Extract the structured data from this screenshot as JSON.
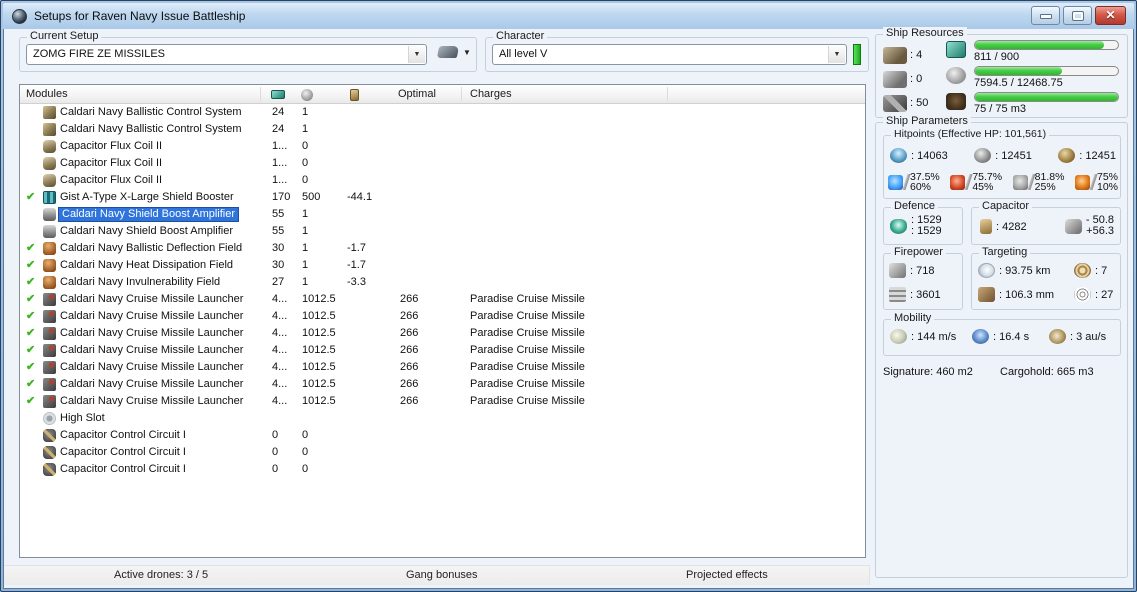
{
  "colors": {
    "accent_green": "#2db82d",
    "selection_blue": "#2e74da",
    "titlebar_blue": "#bcd7ef"
  },
  "window": {
    "title": "Setups for Raven Navy Issue Battleship"
  },
  "toolbar": {
    "current_setup": {
      "label": "Current Setup",
      "value": "ZOMG FIRE ZE MISSILES"
    },
    "character": {
      "label": "Character",
      "value": "All level V"
    }
  },
  "modules": {
    "header": {
      "name": "Modules",
      "optimal": "Optimal",
      "charges": "Charges"
    },
    "check_glyph": "✔",
    "rows": [
      {
        "icon": "bcs",
        "name": "Caldari Navy Ballistic Control System",
        "cpu": "24",
        "pg": "1"
      },
      {
        "icon": "bcs",
        "name": "Caldari Navy Ballistic Control System",
        "cpu": "24",
        "pg": "1"
      },
      {
        "icon": "fluxcoil",
        "name": "Capacitor Flux Coil II",
        "cpu": "1...",
        "pg": "0"
      },
      {
        "icon": "fluxcoil",
        "name": "Capacitor Flux Coil II",
        "cpu": "1...",
        "pg": "0"
      },
      {
        "icon": "fluxcoil",
        "name": "Capacitor Flux Coil II",
        "cpu": "1...",
        "pg": "0"
      },
      {
        "check": true,
        "icon": "booster",
        "name": "Gist A-Type X-Large Shield Booster",
        "cpu": "170",
        "pg": "500",
        "cap": "-44.1"
      },
      {
        "icon": "amplifier",
        "name": "Caldari Navy Shield Boost Amplifier",
        "cpu": "55",
        "pg": "1",
        "selected": true
      },
      {
        "icon": "amplifier",
        "name": "Caldari Navy Shield Boost Amplifier",
        "cpu": "55",
        "pg": "1"
      },
      {
        "check": true,
        "icon": "hardener",
        "name": "Caldari Navy Ballistic Deflection Field",
        "cpu": "30",
        "pg": "1",
        "cap": "-1.7"
      },
      {
        "check": true,
        "icon": "hardener",
        "name": "Caldari Navy Heat Dissipation Field",
        "cpu": "30",
        "pg": "1",
        "cap": "-1.7"
      },
      {
        "check": true,
        "icon": "hardener",
        "name": "Caldari Navy Invulnerability Field",
        "cpu": "27",
        "pg": "1",
        "cap": "-3.3"
      },
      {
        "check": true,
        "icon": "launcher",
        "name": "Caldari Navy Cruise Missile Launcher",
        "cpu": "4...",
        "pg": "1012.5",
        "optimal": "266",
        "charges": "Paradise Cruise Missile"
      },
      {
        "check": true,
        "icon": "launcher",
        "name": "Caldari Navy Cruise Missile Launcher",
        "cpu": "4...",
        "pg": "1012.5",
        "optimal": "266",
        "charges": "Paradise Cruise Missile"
      },
      {
        "check": true,
        "icon": "launcher",
        "name": "Caldari Navy Cruise Missile Launcher",
        "cpu": "4...",
        "pg": "1012.5",
        "optimal": "266",
        "charges": "Paradise Cruise Missile"
      },
      {
        "check": true,
        "icon": "launcher",
        "name": "Caldari Navy Cruise Missile Launcher",
        "cpu": "4...",
        "pg": "1012.5",
        "optimal": "266",
        "charges": "Paradise Cruise Missile"
      },
      {
        "check": true,
        "icon": "launcher",
        "name": "Caldari Navy Cruise Missile Launcher",
        "cpu": "4...",
        "pg": "1012.5",
        "optimal": "266",
        "charges": "Paradise Cruise Missile"
      },
      {
        "check": true,
        "icon": "launcher",
        "name": "Caldari Navy Cruise Missile Launcher",
        "cpu": "4...",
        "pg": "1012.5",
        "optimal": "266",
        "charges": "Paradise Cruise Missile"
      },
      {
        "check": true,
        "icon": "launcher",
        "name": "Caldari Navy Cruise Missile Launcher",
        "cpu": "4...",
        "pg": "1012.5",
        "optimal": "266",
        "charges": "Paradise Cruise Missile"
      },
      {
        "icon": "highslot",
        "name": "High Slot"
      },
      {
        "icon": "rig",
        "name": "Capacitor Control Circuit I",
        "cpu": "0",
        "pg": "0"
      },
      {
        "icon": "rig",
        "name": "Capacitor Control Circuit I",
        "cpu": "0",
        "pg": "0"
      },
      {
        "icon": "rig",
        "name": "Capacitor Control Circuit I",
        "cpu": "0",
        "pg": "0"
      }
    ]
  },
  "statusbar": {
    "active_drones": "Active drones: 3 / 5",
    "gang_bonuses": "Gang bonuses",
    "projected_effects": "Projected effects"
  },
  "ship_resources": {
    "title": "Ship Resources",
    "turret_hardpoints": ": 4",
    "launcher_hardpoints": ": 0",
    "rig_slots": ": 50",
    "cpu": {
      "text": "811 / 900",
      "pct": 90
    },
    "powergrid": {
      "text": "7594.5 / 12468.75",
      "pct": 61
    },
    "dronebay": {
      "text": "75 / 75 m3",
      "pct": 100
    }
  },
  "ship_parameters": {
    "title": "Ship Parameters",
    "hitpoints": {
      "title": "Hitpoints (Effective HP: 101,561)",
      "shield": ": 14063",
      "armor": ": 12451",
      "structure": ": 12451",
      "resists": {
        "em_shield": "37.5%",
        "em_armor": "60%",
        "thermal_shield": "75.7%",
        "thermal_armor": "45%",
        "kinetic_shield": "81.8%",
        "kinetic_armor": "25%",
        "explosive_shield": "75%",
        "explosive_armor": "10%"
      }
    },
    "defence": {
      "title": "Defence",
      "passive_rate": ": 1529",
      "active_rate": ": 1529"
    },
    "capacitor": {
      "title": "Capacitor",
      "amount": ": 4282",
      "usage": "- 50.8",
      "recharge": "+56.3"
    },
    "firepower": {
      "title": "Firepower",
      "dps": ": 718",
      "volley": ": 3601"
    },
    "targeting": {
      "title": "Targeting",
      "range": ": 93.75 km",
      "max_targets": ": 7",
      "scan_resolution": ": 106.3 mm",
      "sensor_strength": ": 27"
    },
    "mobility": {
      "title": "Mobility",
      "speed": ": 144 m/s",
      "align_time": ": 16.4 s",
      "warp_speed": ": 3 au/s"
    },
    "signature": "Signature: 460 m2",
    "cargohold": "Cargohold: 665 m3"
  }
}
